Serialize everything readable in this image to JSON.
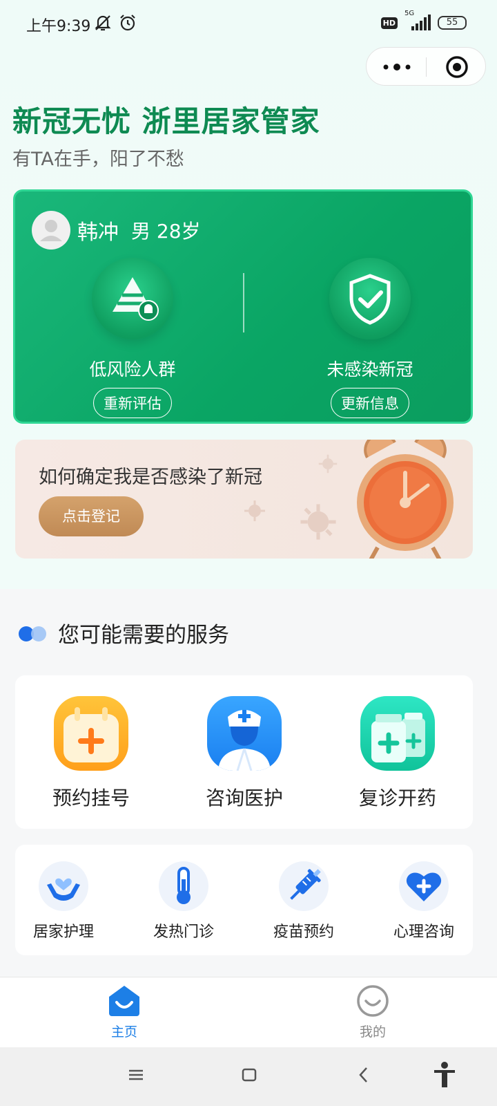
{
  "status_bar": {
    "time": "上午9:39",
    "hd": "HD",
    "network": "5G",
    "battery": "55"
  },
  "hero": {
    "title": "新冠无忧 浙里居家管家",
    "subtitle": "有TA在手，阳了不愁"
  },
  "profile": {
    "name": "韩冲",
    "gender_age": "男  28岁",
    "risk_label": "低风险人群",
    "risk_button": "重新评估",
    "infection_label": "未感染新冠",
    "infection_button": "更新信息"
  },
  "banner": {
    "text": "如何确定我是否感染了新冠",
    "button": "点击登记"
  },
  "services": {
    "section_title": "您可能需要的服务",
    "primary": [
      {
        "label": "预约挂号",
        "icon": "calendar-plus-icon"
      },
      {
        "label": "咨询医护",
        "icon": "doctor-icon"
      },
      {
        "label": "复诊开药",
        "icon": "medicine-bottle-icon"
      }
    ],
    "secondary": [
      {
        "label": "居家护理",
        "icon": "care-hands-icon"
      },
      {
        "label": "发热门诊",
        "icon": "thermometer-icon"
      },
      {
        "label": "疫苗预约",
        "icon": "syringe-icon"
      },
      {
        "label": "心理咨询",
        "icon": "heart-plus-icon"
      }
    ]
  },
  "tabs": [
    {
      "label": "主页",
      "icon": "home-icon",
      "active": true
    },
    {
      "label": "我的",
      "icon": "smile-icon",
      "active": false
    }
  ],
  "colors": {
    "brand_green": "#0e8a52",
    "card_green": "#0aa564",
    "tab_active": "#1d7fe6"
  }
}
